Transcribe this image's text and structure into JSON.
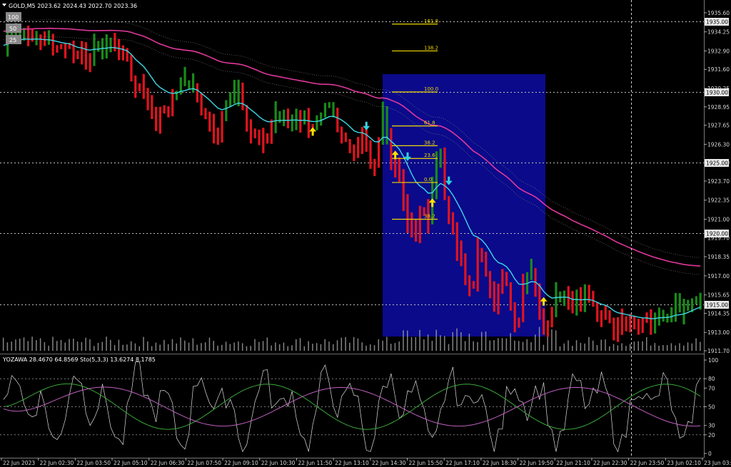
{
  "header": {
    "symbol_line": "GOLD,M5  2023.62 2024.43 2022.70 2023.36",
    "levels": [
      "100",
      "50",
      "25"
    ]
  },
  "subwindow": {
    "label": "YOZAWA 28.4670 64.8569  Sto(5,3,3) 13.6274 8.1785",
    "ticks": [
      "100",
      "80",
      "70",
      "50",
      "30",
      "20",
      "0"
    ]
  },
  "colors": {
    "background": "#000000",
    "bull": "#1a8a1a",
    "bear": "#e0141e",
    "ma_fast": "#3fd6e6",
    "ma_slow": "#e0389a",
    "fib_box": "#0a0a8a",
    "fib_line": "#f0d800",
    "arrow_up": "#ffe000",
    "arrow_down": "#2fd2e0",
    "volume": "#b0b0b0"
  },
  "chart_data": [
    {
      "type": "candlestick",
      "title": "GOLD,M5",
      "ylim": [
        1911.7,
        1936.2
      ],
      "y_ticks": [
        "1935.60",
        "1934.25",
        "1932.90",
        "1931.60",
        "1930.25",
        "1928.95",
        "1927.65",
        "1926.30",
        "1925.00",
        "1923.70",
        "1922.35",
        "1921.00",
        "1919.70",
        "1918.35",
        "1917.00",
        "1915.65",
        "1914.35",
        "1913.00",
        "1911.70"
      ],
      "highlighted_levels": [
        "1935.00",
        "1930.00",
        "1925.00",
        "1920.00",
        "1915.00"
      ],
      "x_ticks": [
        "22 Jun 2023",
        "22 Jun 02:30",
        "22 Jun 03:50",
        "22 Jun 05:10",
        "22 Jun 06:30",
        "22 Jun 07:50",
        "22 Jun 09:10",
        "22 Jun 10:30",
        "22 Jun 11:50",
        "22 Jun 13:10",
        "22 Jun 14:30",
        "22 Jun 15:50",
        "22 Jun 17:10",
        "22 Jun 18:30",
        "22 Jun 19:50",
        "22 Jun 21:10",
        "22 Jun 22:30",
        "22 Jun 23:50",
        "23 Jun 02:10",
        "23 Jun 03:30"
      ],
      "fibonacci": {
        "levels": [
          "161.8",
          "138.2",
          "100.0",
          "61.8",
          "38.2",
          "23.6",
          "0.0",
          "38.2"
        ],
        "prices": [
          1934.8,
          1932.9,
          1930.0,
          1927.6,
          1926.2,
          1925.3,
          1923.6,
          1921.0
        ]
      },
      "price_path": [
        [
          1933.3,
          1934.0,
          1934.5,
          1934.1,
          1934.4,
          1933.8,
          1933.5,
          1934.0,
          1933.4,
          1933.7,
          1933.2
        ],
        [
          1933.3,
          1932.9,
          1933.4,
          1932.6,
          1932.3,
          1933.0,
          1932.1,
          1933.5,
          1932.8,
          1933.6,
          1933.1
        ],
        [
          1933.4,
          1932.9,
          1932.6,
          1932.2,
          1931.0,
          1929.8,
          1930.6,
          1929.2,
          1928.3,
          1927.8
        ],
        [
          1929.1,
          1928.7,
          1929.3,
          1930.2,
          1930.8,
          1930.4,
          1930.9,
          1929.9,
          1928.4,
          1928.1
        ],
        [
          1927.6,
          1926.8,
          1927.8,
          1929.4,
          1929.9,
          1930.5,
          1929.4,
          1928.0,
          1926.9,
          1927.2
        ],
        [
          1926.3,
          1926.9,
          1927.4,
          1928.5,
          1928.1,
          1928.2,
          1927.9,
          1928.3,
          1927.8,
          1928.1
        ],
        [
          1927.3,
          1927.6,
          1928.1,
          1928.9,
          1929.1,
          1928.2,
          1927.2,
          1926.8,
          1925.9,
          1925.4
        ],
        [
          1926.6,
          1927.1,
          1925.0,
          1924.9,
          1926.5,
          1929.6,
          1925.0,
          1924.5,
          1924.2,
          1921.8
        ],
        [
          1920.5,
          1919.8,
          1921.0,
          1921.8,
          1920.9,
          1924.0,
          1927.1,
          1922.7,
          1921.5,
          1919.8
        ],
        [
          1918.6,
          1917.6,
          1916.4,
          1916.3,
          1919.3,
          1917.8,
          1916.4,
          1914.8,
          1915.8,
          1917.4
        ],
        [
          1916.2,
          1914.1,
          1913.2,
          1916.3,
          1917.0,
          1917.4,
          1916.0,
          1913.3,
          1913.6,
          1914.4
        ],
        [
          1916.1,
          1915.5,
          1915.7,
          1914.5,
          1915.3,
          1915.0,
          1915.7,
          1914.9,
          1914.2,
          1914.1
        ],
        [
          1914.6,
          1913.4,
          1912.9,
          1914.2,
          1914.0,
          1913.8,
          1913.9,
          1913.6,
          1914.0,
          1913.7
        ],
        [
          1914.1,
          1914.3,
          1914.0,
          1914.5,
          1914.8,
          1914.3,
          1914.8,
          1915.2,
          1915.6,
          1915.3
        ]
      ]
    },
    {
      "type": "line",
      "title": "YOZAWA / Sto(5,3,3)",
      "ylim": [
        0,
        100
      ],
      "series": [
        {
          "name": "YOZAWA",
          "value": 28.467
        },
        {
          "name": "YOZAWA",
          "value": 64.8569
        },
        {
          "name": "Sto(5,3,3)",
          "value": 13.6274
        },
        {
          "name": "Sto(5,3,3)",
          "value": 8.1785
        }
      ]
    }
  ]
}
